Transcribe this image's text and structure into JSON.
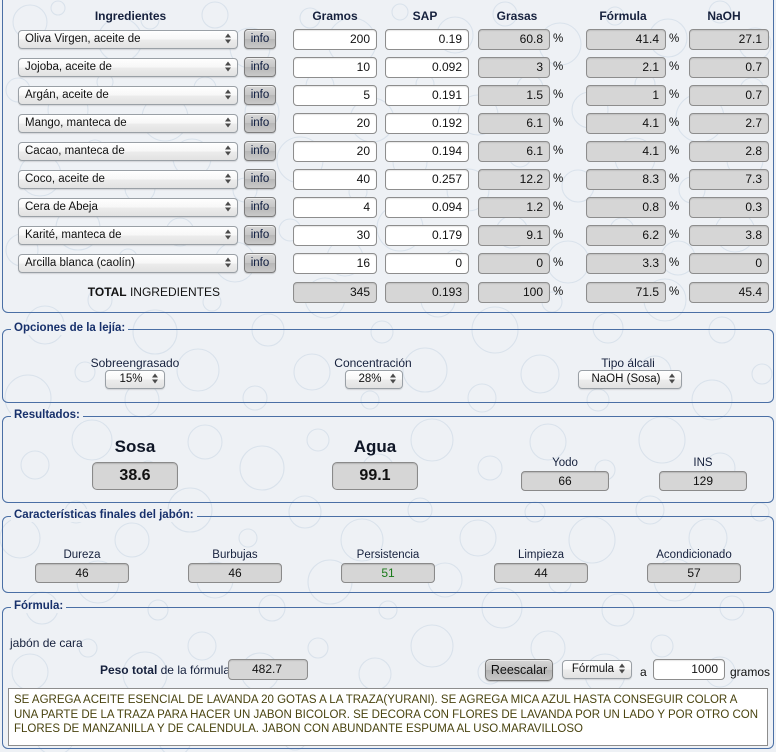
{
  "table": {
    "headers": [
      "Ingredientes",
      "Gramos",
      "SAP",
      "Grasas",
      "Fórmula",
      "NaOH"
    ],
    "info_label": "info",
    "percent_symbol": "%",
    "rows": [
      {
        "ingredient": "Oliva Virgen, aceite de",
        "gramos": "200",
        "sap": "0.19",
        "grasas": "60.8",
        "formula": "41.4",
        "naoh": "27.1"
      },
      {
        "ingredient": "Jojoba, aceite de",
        "gramos": "10",
        "sap": "0.092",
        "grasas": "3",
        "formula": "2.1",
        "naoh": "0.7"
      },
      {
        "ingredient": "Argán, aceite de",
        "gramos": "5",
        "sap": "0.191",
        "grasas": "1.5",
        "formula": "1",
        "naoh": "0.7"
      },
      {
        "ingredient": "Mango, manteca de",
        "gramos": "20",
        "sap": "0.192",
        "grasas": "6.1",
        "formula": "4.1",
        "naoh": "2.7"
      },
      {
        "ingredient": "Cacao, manteca de",
        "gramos": "20",
        "sap": "0.194",
        "grasas": "6.1",
        "formula": "4.1",
        "naoh": "2.8"
      },
      {
        "ingredient": "Coco, aceite de",
        "gramos": "40",
        "sap": "0.257",
        "grasas": "12.2",
        "formula": "8.3",
        "naoh": "7.3"
      },
      {
        "ingredient": "Cera de Abeja",
        "gramos": "4",
        "sap": "0.094",
        "grasas": "1.2",
        "formula": "0.8",
        "naoh": "0.3"
      },
      {
        "ingredient": "Karité, manteca de",
        "gramos": "30",
        "sap": "0.179",
        "grasas": "9.1",
        "formula": "6.2",
        "naoh": "3.8"
      },
      {
        "ingredient": "Arcilla blanca (caolín)",
        "gramos": "16",
        "sap": "0",
        "grasas": "0",
        "formula": "3.3",
        "naoh": "0"
      }
    ],
    "total": {
      "label_bold": "TOTAL",
      "label_rest": " INGREDIENTES",
      "gramos": "345",
      "sap": "0.193",
      "grasas": "100",
      "formula": "71.5",
      "naoh": "45.4"
    }
  },
  "lye_options": {
    "legend": "Opciones de la lejía:",
    "superfat": {
      "label": "Sobreengrasado",
      "value": "15%"
    },
    "concentration": {
      "label": "Concentración",
      "value": "28%"
    },
    "alkali": {
      "label": "Tipo álcali",
      "value": "NaOH (Sosa)"
    }
  },
  "results": {
    "legend": "Resultados:",
    "sosa": {
      "label": "Sosa",
      "value": "38.6"
    },
    "agua": {
      "label": "Agua",
      "value": "99.1"
    },
    "yodo": {
      "label": "Yodo",
      "value": "66"
    },
    "ins": {
      "label": "INS",
      "value": "129"
    }
  },
  "qualities": {
    "legend": "Características finales del jabón:",
    "items": [
      {
        "label": "Dureza",
        "value": "46",
        "color": "#111111"
      },
      {
        "label": "Burbujas",
        "value": "46",
        "color": "#111111"
      },
      {
        "label": "Persistencia",
        "value": "51",
        "color": "#1a7a1a"
      },
      {
        "label": "Limpieza",
        "value": "44",
        "color": "#111111"
      },
      {
        "label": "Acondicionado",
        "value": "57",
        "color": "#111111"
      }
    ]
  },
  "formula": {
    "legend": "Fórmula:",
    "name": "jabón de cara",
    "weight_label_bold": "Peso total",
    "weight_label_rest": " de la fórmula",
    "weight_value": "482.7",
    "rescale_button": "Reescalar",
    "rescale_mode": "Fórmula",
    "connector": "a",
    "rescale_target": "1000",
    "units": "gramos",
    "notes": "SE AGREGA ACEITE ESENCIAL DE LAVANDA 20 GOTAS A LA TRAZA(YURANI). SE AGREGA MICA AZUL HASTA CONSEGUIR COLOR A UNA PARTE DE LA TRAZA PARA HACER UN JABON BICOLOR. SE DECORA CON FLORES DE LAVANDA POR UN LADO Y POR OTRO CON FLORES DE MANZANILLA Y DE CALENDULA. JABON CON ABUNDANTE ESPUMA AL USO.MARAVILLOSO"
  },
  "theme": {
    "page_bg": "#eef1f5",
    "fieldset_border": "#4a6fa5",
    "legend_color": "#17306b",
    "readonly_bg": "#d6d6d6",
    "accent_green": "#1a7a1a"
  }
}
